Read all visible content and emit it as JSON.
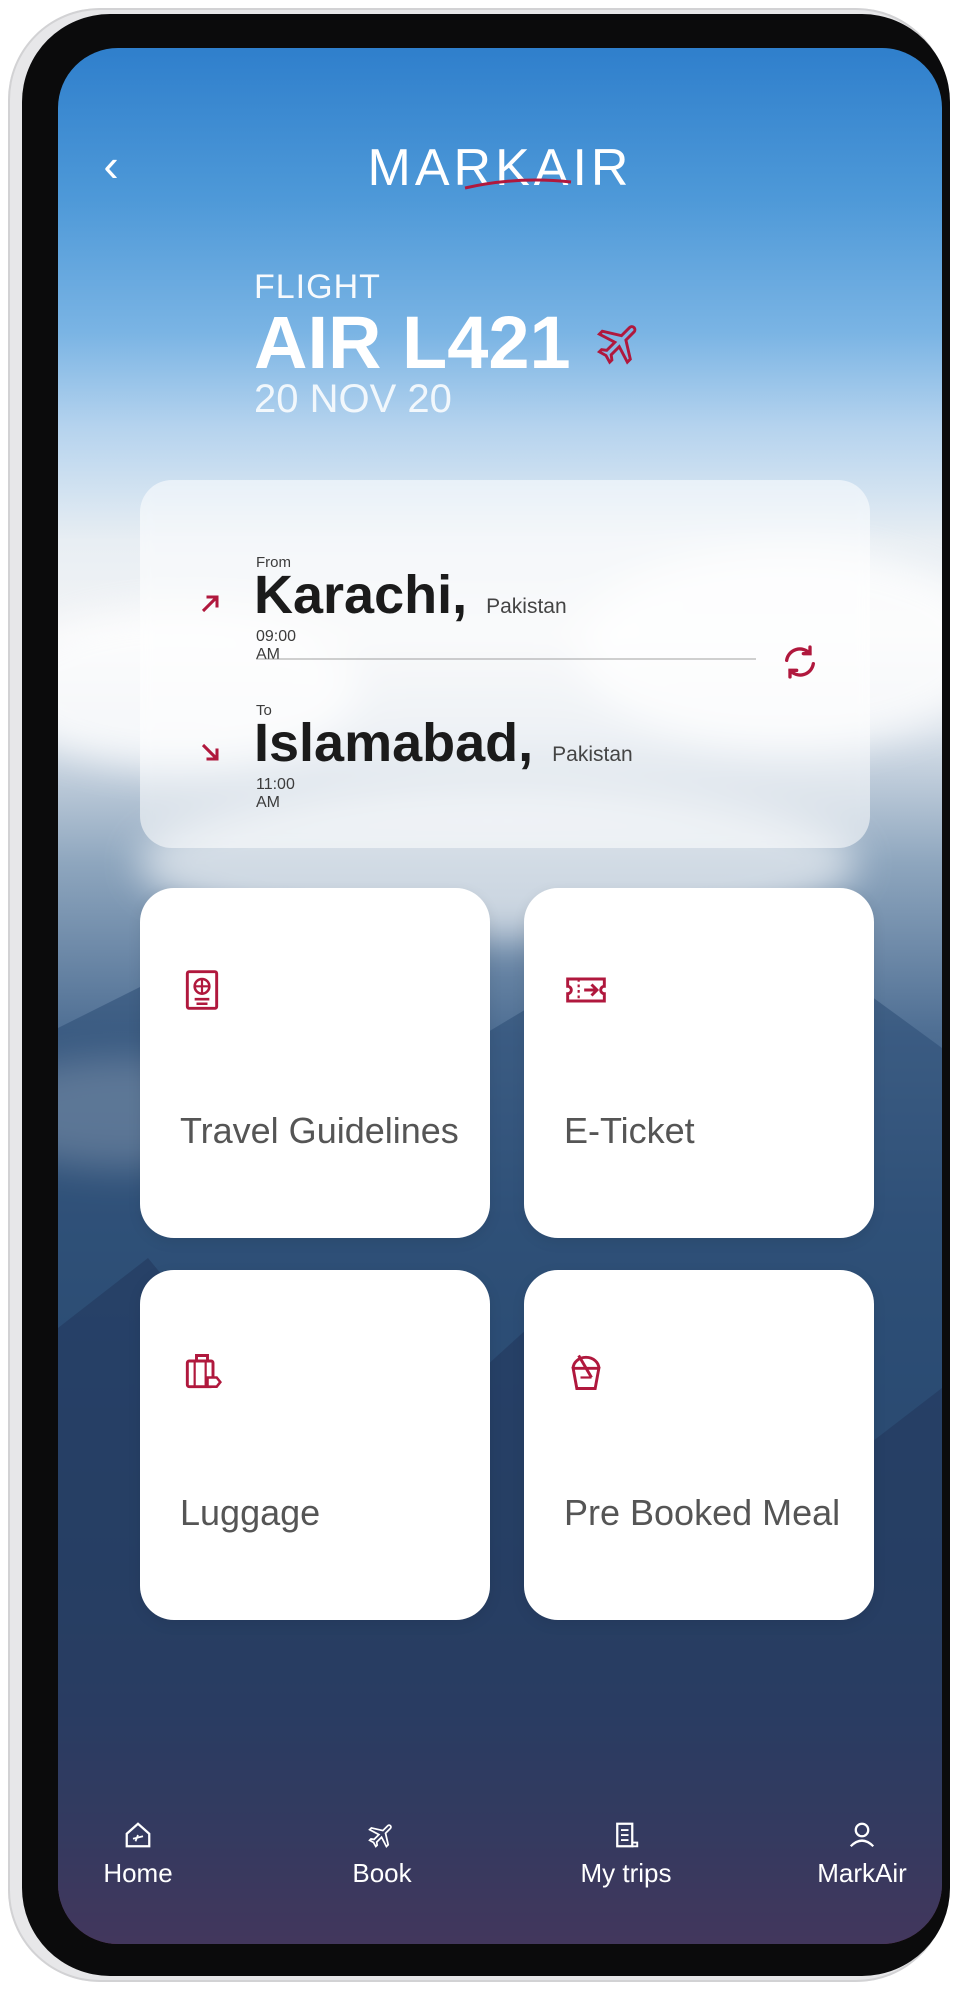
{
  "header": {
    "back_symbol": "‹",
    "brand": "MARKAIR"
  },
  "flight": {
    "label": "FLIGHT",
    "number": "AIR L421",
    "date": "20 NOV 20"
  },
  "route": {
    "from_label": "From",
    "from_city": "Karachi,",
    "from_country": "Pakistan",
    "from_time": "09:00 AM",
    "to_label": "To",
    "to_city": "Islamabad,",
    "to_country": "Pakistan",
    "to_time": "11:00 AM"
  },
  "tiles": {
    "guidelines": "Travel Guidelines",
    "eticket": "E-Ticket",
    "luggage": "Luggage",
    "meal": "Pre Booked Meal"
  },
  "nav": {
    "home": "Home",
    "book": "Book",
    "trips": "My trips",
    "markair": "MarkAir"
  },
  "colors": {
    "accent": "#b0183d",
    "tile_bg": "#ffffff"
  },
  "icons": {
    "plane": "plane-icon",
    "passport": "passport-icon",
    "ticket": "ticket-icon",
    "luggage": "luggage-icon",
    "meal": "meal-icon"
  }
}
